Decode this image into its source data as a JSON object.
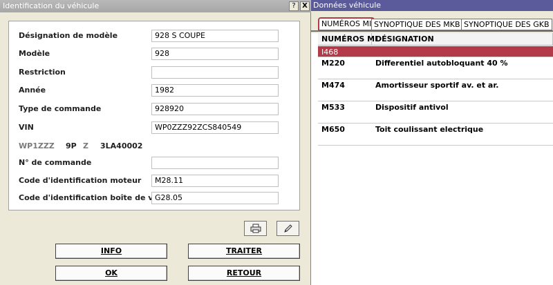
{
  "left_window": {
    "title": "Identification du véhicule",
    "help_btn": "?",
    "close_btn": "X",
    "fields": [
      {
        "label": "Désignation de modèle",
        "value": "928 S COUPE"
      },
      {
        "label": "Modèle",
        "value": "928"
      },
      {
        "label": "Restriction",
        "value": ""
      },
      {
        "label": "Année",
        "value": "1982"
      },
      {
        "label": "Type de commande",
        "value": "928920"
      },
      {
        "label": "VIN",
        "value": "WP0ZZZ92ZCS840549"
      },
      {
        "label": "N° de commande",
        "value": ""
      },
      {
        "label": "Code d'identification moteur",
        "value": "M28.11"
      },
      {
        "label": "Code d'identification boîte de vitesse",
        "value": "G28.05"
      }
    ],
    "vin_parts": [
      "WP1ZZZ",
      "9P",
      "Z",
      "3LA40002"
    ],
    "icons": {
      "print": "printer-icon",
      "edit": "pencil-icon"
    },
    "buttons": {
      "info": "INFO",
      "traiter": "TRAITER",
      "ok": "OK",
      "retour": "RETOUR"
    }
  },
  "right_window": {
    "title": "Données véhicule",
    "tabs": [
      "NUMÉROS MI",
      "SYNOPTIQUE DES MKB",
      "SYNOPTIQUE DES GKB"
    ],
    "table": {
      "headers": [
        "NUMÉROS MI",
        "DÉSIGNATION"
      ],
      "rows": [
        {
          "code": "I468",
          "designation": "",
          "selected": true
        },
        {
          "code": "M220",
          "designation": "Differentiel autobloquant 40 %"
        },
        {
          "code": "M474",
          "designation": "Amortisseur sportif av. et ar."
        },
        {
          "code": "M533",
          "designation": "Dispositif antivol"
        },
        {
          "code": "M650",
          "designation": "Toit coulissant electrique"
        }
      ]
    }
  },
  "colors": {
    "accent": "#b33b49",
    "titlebar_right": "#5b5b9b"
  }
}
